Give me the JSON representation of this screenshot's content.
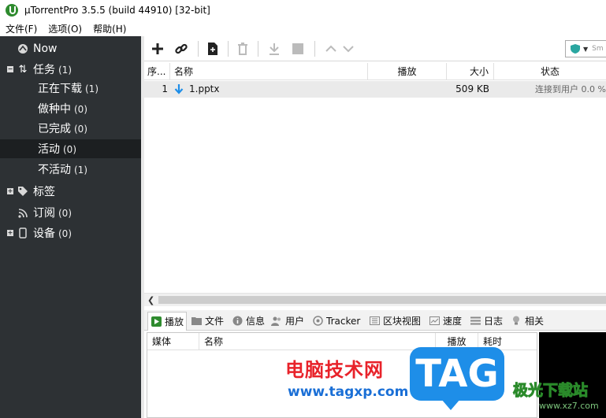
{
  "window": {
    "title": "µTorrentPro 3.5.5  (build 44910) [32-bit]"
  },
  "menu": [
    "文件(F)",
    "选项(O)",
    "帮助(H)"
  ],
  "sidebar": {
    "items": [
      {
        "label": "Now",
        "count": "",
        "icon": "now-icon"
      },
      {
        "label": "任务",
        "count": "(1)",
        "icon": "transfer-arrows-icon"
      },
      {
        "label": "正在下载",
        "count": "(1)"
      },
      {
        "label": "做种中",
        "count": "(0)"
      },
      {
        "label": "已完成",
        "count": "(0)"
      },
      {
        "label": "活动",
        "count": "(0)"
      },
      {
        "label": "不活动",
        "count": "(1)"
      },
      {
        "label": "标签",
        "count": "",
        "icon": "tag-icon"
      },
      {
        "label": "订阅",
        "count": "(0)",
        "icon": "rss-icon"
      },
      {
        "label": "设备",
        "count": "(0)",
        "icon": "device-icon"
      }
    ],
    "selected": "活动"
  },
  "toolbar": {
    "search_placeholder": "Sm"
  },
  "grid": {
    "columns": [
      "序...",
      "名称",
      "播放",
      "大小",
      "状态"
    ],
    "rows": [
      {
        "index": "1",
        "name": "1.pptx",
        "play": "",
        "size": "509 KB",
        "status": "连接到用户 0.0 %"
      }
    ]
  },
  "bottom_tabs": [
    "播放",
    "文件",
    "信息",
    "用户",
    "Tracker",
    "区块视图",
    "速度",
    "日志",
    "相关"
  ],
  "peers": {
    "columns": [
      "媒体",
      "名称",
      "播放",
      "耗时"
    ]
  },
  "watermark": {
    "cn": "电脑技术网",
    "url": "www.tagxp.com",
    "tag": "TAG",
    "site": "极光下载站",
    "site_url": "www.xz7.com"
  },
  "colors": {
    "sidebar_bg": "#2d3134",
    "sidebar_selected": "#1c1f21",
    "download_arrow": "#1e8ee8",
    "app_icon": "#2e8b2e"
  }
}
